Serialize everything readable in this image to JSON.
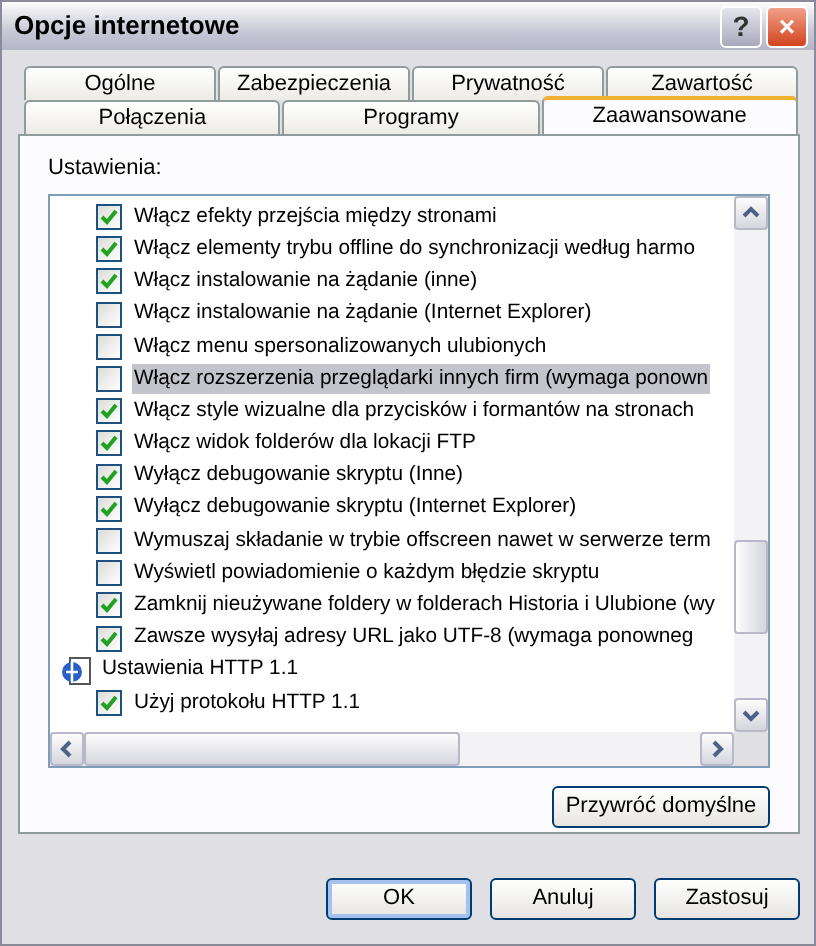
{
  "window": {
    "title": "Opcje internetowe"
  },
  "title_buttons": [
    {
      "kind": "help",
      "label": "?"
    },
    {
      "kind": "close",
      "label": "×"
    }
  ],
  "tab_rows": [
    {
      "tabs": [
        {
          "label": "Ogólne",
          "selected": false
        },
        {
          "label": "Zabezpieczenia",
          "selected": false
        },
        {
          "label": "Prywatność",
          "selected": false
        },
        {
          "label": "Zawartość",
          "selected": false
        }
      ]
    },
    {
      "tabs": [
        {
          "label": "Połączenia",
          "selected": false
        },
        {
          "label": "Programy",
          "selected": false
        },
        {
          "label": "Zaawansowane",
          "selected": true
        }
      ]
    }
  ],
  "settings_label": "Ustawienia:",
  "settings": [
    {
      "kind": "checkbox",
      "label": "Włącz efekty przejścia między stronami",
      "checked": true,
      "selected": false
    },
    {
      "kind": "checkbox",
      "label": "Włącz elementy trybu offline do synchronizacji według harmo",
      "checked": true,
      "selected": false
    },
    {
      "kind": "checkbox",
      "label": "Włącz instalowanie na żądanie (inne)",
      "checked": true,
      "selected": false
    },
    {
      "kind": "checkbox",
      "label": "Włącz instalowanie na żądanie (Internet Explorer)",
      "checked": false,
      "selected": false
    },
    {
      "kind": "checkbox",
      "label": "Włącz menu spersonalizowanych ulubionych",
      "checked": false,
      "selected": false
    },
    {
      "kind": "checkbox",
      "label": "Włącz rozszerzenia przeglądarki innych firm (wymaga ponown",
      "checked": false,
      "selected": true
    },
    {
      "kind": "checkbox",
      "label": "Włącz style wizualne dla przycisków i formantów na stronach",
      "checked": true,
      "selected": false
    },
    {
      "kind": "checkbox",
      "label": "Włącz widok folderów dla lokacji FTP",
      "checked": true,
      "selected": false
    },
    {
      "kind": "checkbox",
      "label": "Wyłącz debugowanie skryptu (Inne)",
      "checked": true,
      "selected": false
    },
    {
      "kind": "checkbox",
      "label": "Wyłącz debugowanie skryptu (Internet Explorer)",
      "checked": true,
      "selected": false
    },
    {
      "kind": "checkbox",
      "label": "Wymuszaj składanie w trybie offscreen nawet w serwerze term",
      "checked": false,
      "selected": false
    },
    {
      "kind": "checkbox",
      "label": "Wyświetl powiadomienie o każdym błędzie skryptu",
      "checked": false,
      "selected": false
    },
    {
      "kind": "checkbox",
      "label": "Zamknij nieużywane foldery w folderach Historia i Ulubione (wy",
      "checked": true,
      "selected": false
    },
    {
      "kind": "checkbox",
      "label": "Zawsze wysyłaj adresy URL jako UTF-8 (wymaga ponowneg",
      "checked": true,
      "selected": false
    },
    {
      "kind": "group",
      "label": "Ustawienia HTTP 1.1",
      "selected": false
    },
    {
      "kind": "checkbox",
      "label": "Użyj protokołu HTTP 1.1",
      "checked": true,
      "selected": false
    }
  ],
  "restore_button": "Przywróć domyślne",
  "buttons": [
    {
      "label": "OK",
      "kind": "default"
    },
    {
      "label": "Anuluj",
      "kind": "normal"
    },
    {
      "label": "Zastosuj",
      "kind": "normal"
    }
  ]
}
